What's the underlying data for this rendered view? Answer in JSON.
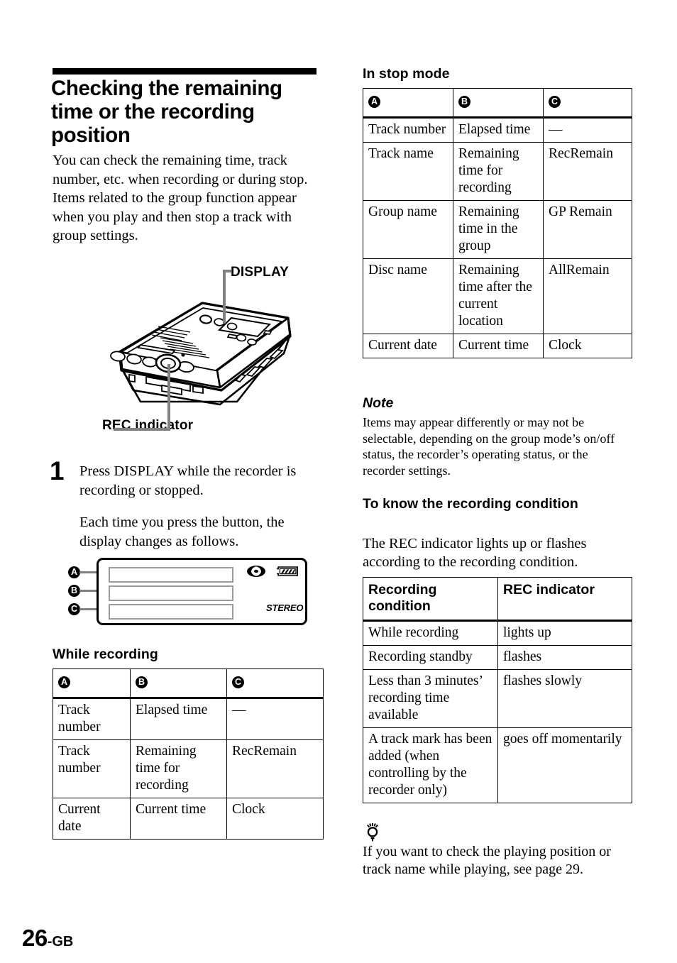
{
  "section": {
    "title": "Checking the remaining time or the recording position",
    "intro_paragraph_1": "You can check the remaining time, track number, etc. when recording or during stop.",
    "intro_paragraph_2": "Items related to the group function appear when you play and then stop a track with group settings."
  },
  "figure": {
    "display_label": "DISPLAY",
    "rec_indicator_label": "REC indicator",
    "device_name": "minidisc-recorder-illustration"
  },
  "step": {
    "number": "1",
    "line_1": "Press DISPLAY while the recorder is recording or stopped.",
    "line_2": "Each time you press the button, the display changes as follows."
  },
  "display_diagram": {
    "markers": [
      "A",
      "B",
      "C"
    ],
    "stereo_label": "STEREO",
    "icons": [
      "disc-icon",
      "battery-icon"
    ]
  },
  "while_recording": {
    "heading": "While recording",
    "headers": [
      "A",
      "B",
      "C"
    ],
    "rows": [
      [
        "Track number",
        "Elapsed time",
        "—"
      ],
      [
        "Track number",
        "Remaining time for recording",
        "RecRemain"
      ],
      [
        "Current date",
        "Current time",
        "Clock"
      ]
    ]
  },
  "in_stop_mode": {
    "heading": "In stop mode",
    "headers": [
      "A",
      "B",
      "C"
    ],
    "rows": [
      [
        "Track number",
        "Elapsed time",
        "—"
      ],
      [
        "Track name",
        "Remaining time for recording",
        "RecRemain"
      ],
      [
        "Group name",
        "Remaining time in the group",
        "GP Remain"
      ],
      [
        "Disc name",
        "Remaining time after the current location",
        "AllRemain"
      ],
      [
        "Current date",
        "Current time",
        "Clock"
      ]
    ]
  },
  "note": {
    "heading": "Note",
    "text": "Items may appear differently or may not be selectable, depending on the group mode’s on/off status, the recorder’s operating status, or the recorder settings."
  },
  "recording_condition": {
    "heading": "To know the recording condition",
    "intro": "The REC indicator lights up or flashes according to the recording condition.",
    "headers": [
      "Recording condition",
      "REC indicator"
    ],
    "rows": [
      [
        "While recording",
        "lights up"
      ],
      [
        "Recording standby",
        "flashes"
      ],
      [
        "Less than 3 minutes’ recording time available",
        "flashes slowly"
      ],
      [
        "A track mark has been added (when controlling by the recorder only)",
        "goes off momentarily"
      ]
    ]
  },
  "tip": {
    "icon": "lightbulb-tip-icon",
    "text": "If you want to check the playing position or track name while playing, see page 29."
  },
  "folio": {
    "number": "26",
    "suffix": "-GB"
  }
}
